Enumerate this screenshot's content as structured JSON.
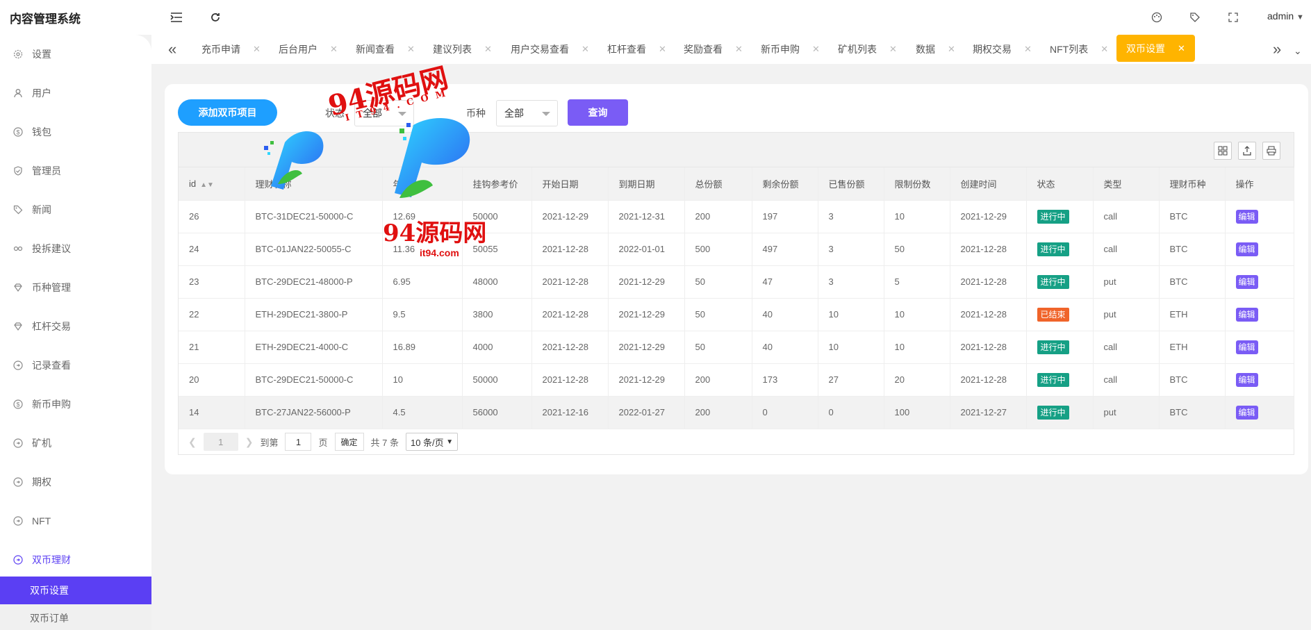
{
  "app": {
    "title": "内容管理系统",
    "user": "admin"
  },
  "sidebar": {
    "items": [
      {
        "label": "设置",
        "icon": "gear-icon"
      },
      {
        "label": "用户",
        "icon": "user-icon"
      },
      {
        "label": "钱包",
        "icon": "coin-icon"
      },
      {
        "label": "管理员",
        "icon": "shield-icon"
      },
      {
        "label": "新闻",
        "icon": "tag-icon"
      },
      {
        "label": "投拆建议",
        "icon": "link-icon"
      },
      {
        "label": "币种管理",
        "icon": "diamond-icon"
      },
      {
        "label": "杠杆交易",
        "icon": "diamond-icon"
      },
      {
        "label": "记录查看",
        "icon": "circle-arrow-icon"
      },
      {
        "label": "新币申购",
        "icon": "coin-icon"
      },
      {
        "label": "矿机",
        "icon": "circle-arrow-icon"
      },
      {
        "label": "期权",
        "icon": "circle-arrow-icon"
      },
      {
        "label": "NFT",
        "icon": "circle-arrow-icon"
      },
      {
        "label": "双币理财",
        "icon": "circle-arrow-icon"
      }
    ],
    "sub_items": [
      {
        "label": "双币设置"
      },
      {
        "label": "双币订单"
      }
    ]
  },
  "tabs": [
    {
      "label": "充币申请"
    },
    {
      "label": "后台用户"
    },
    {
      "label": "新闻查看"
    },
    {
      "label": "建议列表"
    },
    {
      "label": "用户交易查看"
    },
    {
      "label": "杠杆查看"
    },
    {
      "label": "奖励查看"
    },
    {
      "label": "新币申购"
    },
    {
      "label": "矿机列表"
    },
    {
      "label": "数据"
    },
    {
      "label": "期权交易"
    },
    {
      "label": "NFT列表"
    },
    {
      "label": "双币设置"
    }
  ],
  "toolbar": {
    "add_label": "添加双币项目",
    "status_label": "状态",
    "status_value": "全部",
    "coin_label": "币种",
    "coin_value": "全部",
    "query_label": "查询"
  },
  "table": {
    "headers": [
      "id",
      "理财名称",
      "年化",
      "挂钩参考价",
      "开始日期",
      "到期日期",
      "总份额",
      "剩余份额",
      "已售份额",
      "限制份数",
      "创建时间",
      "状态",
      "类型",
      "理财币种",
      "操作"
    ],
    "edit_label": "编辑",
    "rows": [
      {
        "id": "26",
        "name": "BTC-31DEC21-50000-C",
        "apy": "12.69",
        "ref": "50000",
        "start": "2021-12-29",
        "end": "2021-12-31",
        "total": "200",
        "remain": "197",
        "sold": "3",
        "limit": "10",
        "created": "2021-12-29",
        "status": "进行中",
        "status_kind": "ok",
        "type": "call",
        "coin": "BTC"
      },
      {
        "id": "24",
        "name": "BTC-01JAN22-50055-C",
        "apy": "11.36",
        "ref": "50055",
        "start": "2021-12-28",
        "end": "2022-01-01",
        "total": "500",
        "remain": "497",
        "sold": "3",
        "limit": "50",
        "created": "2021-12-28",
        "status": "进行中",
        "status_kind": "ok",
        "type": "call",
        "coin": "BTC"
      },
      {
        "id": "23",
        "name": "BTC-29DEC21-48000-P",
        "apy": "6.95",
        "ref": "48000",
        "start": "2021-12-28",
        "end": "2021-12-29",
        "total": "50",
        "remain": "47",
        "sold": "3",
        "limit": "5",
        "created": "2021-12-28",
        "status": "进行中",
        "status_kind": "ok",
        "type": "put",
        "coin": "BTC"
      },
      {
        "id": "22",
        "name": "ETH-29DEC21-3800-P",
        "apy": "9.5",
        "ref": "3800",
        "start": "2021-12-28",
        "end": "2021-12-29",
        "total": "50",
        "remain": "40",
        "sold": "10",
        "limit": "10",
        "created": "2021-12-28",
        "status": "已结束",
        "status_kind": "end",
        "type": "put",
        "coin": "ETH"
      },
      {
        "id": "21",
        "name": "ETH-29DEC21-4000-C",
        "apy": "16.89",
        "ref": "4000",
        "start": "2021-12-28",
        "end": "2021-12-29",
        "total": "50",
        "remain": "40",
        "sold": "10",
        "limit": "10",
        "created": "2021-12-28",
        "status": "进行中",
        "status_kind": "ok",
        "type": "call",
        "coin": "ETH"
      },
      {
        "id": "20",
        "name": "BTC-29DEC21-50000-C",
        "apy": "10",
        "ref": "50000",
        "start": "2021-12-28",
        "end": "2021-12-29",
        "total": "200",
        "remain": "173",
        "sold": "27",
        "limit": "20",
        "created": "2021-12-28",
        "status": "进行中",
        "status_kind": "ok",
        "type": "call",
        "coin": "BTC"
      },
      {
        "id": "14",
        "name": "BTC-27JAN22-56000-P",
        "apy": "4.5",
        "ref": "56000",
        "start": "2021-12-16",
        "end": "2022-01-27",
        "total": "200",
        "remain": "0",
        "sold": "0",
        "limit": "100",
        "created": "2021-12-27",
        "status": "进行中",
        "status_kind": "ok",
        "type": "put",
        "coin": "BTC"
      }
    ]
  },
  "pager": {
    "current": "1",
    "goto_label": "到第",
    "goto_value": "1",
    "page_unit": "页",
    "confirm": "确定",
    "total": "共 7 条",
    "page_size": "10 条/页"
  },
  "watermark": {
    "big": "94源码网",
    "spaced": "I T 9 4 . C O M",
    "small": "94源码网",
    "url": "it94.com"
  },
  "colors": {
    "accent": "#5b3ff3",
    "add": "#1e9fff",
    "query": "#7a5cf5",
    "tab_active": "#ffb400",
    "ok": "#16a085",
    "end": "#f0642a"
  }
}
